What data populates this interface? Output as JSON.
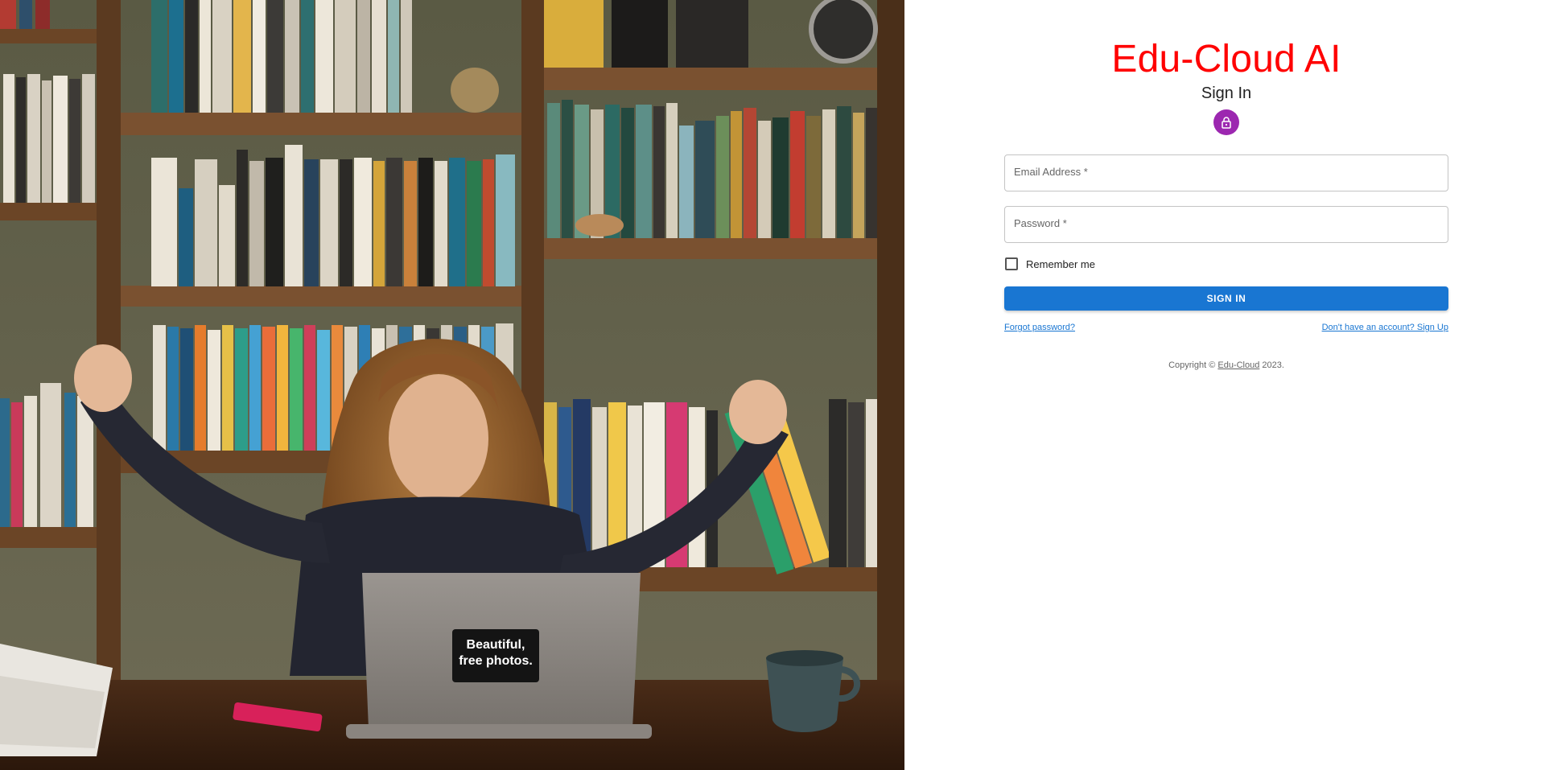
{
  "brand": {
    "title": "Edu-Cloud AI",
    "color": "#ff0000"
  },
  "form": {
    "heading": "Sign In",
    "avatar_icon": "lock-icon",
    "avatar_color": "#9c27b0",
    "email": {
      "label": "Email Address *",
      "value": ""
    },
    "password": {
      "label": "Password *",
      "value": ""
    },
    "remember": {
      "label": "Remember me",
      "checked": false
    },
    "submit_label": "SIGN IN",
    "submit_color": "#1976d2",
    "forgot_label": "Forgot password?",
    "signup_label": "Don't have an account? Sign Up"
  },
  "footer": {
    "prefix": "Copyright © ",
    "link": "Edu-Cloud",
    "suffix": " 2023."
  },
  "hero": {
    "image_badge_line1": "Beautiful,",
    "image_badge_line2": "free photos."
  }
}
